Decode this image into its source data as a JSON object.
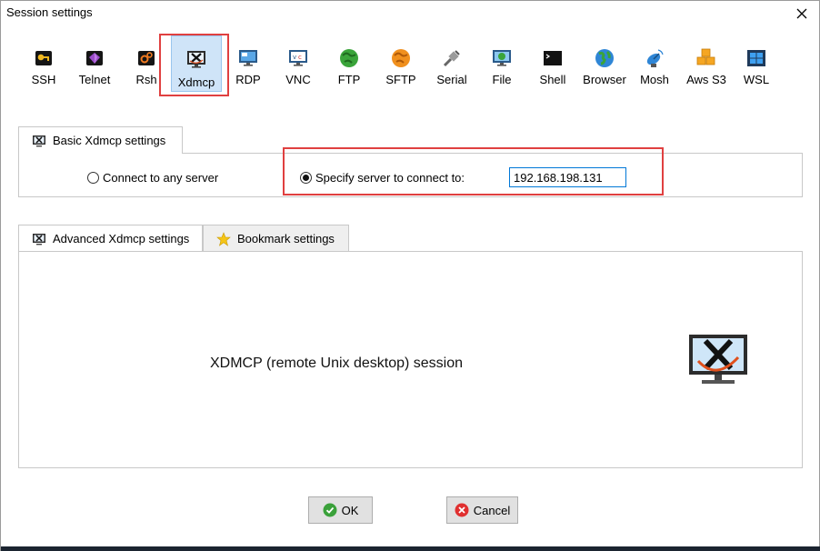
{
  "window": {
    "title": "Session settings"
  },
  "session_types": [
    {
      "label": "SSH",
      "icon": "key-icon"
    },
    {
      "label": "Telnet",
      "icon": "telnet-gem-icon"
    },
    {
      "label": "Rsh",
      "icon": "rsh-gears-icon"
    },
    {
      "label": "Xdmcp",
      "icon": "x-window-icon",
      "selected": true
    },
    {
      "label": "RDP",
      "icon": "rdp-monitor-icon"
    },
    {
      "label": "VNC",
      "icon": "vnc-monitor-icon"
    },
    {
      "label": "FTP",
      "icon": "ftp-globe-icon"
    },
    {
      "label": "SFTP",
      "icon": "sftp-globe-icon"
    },
    {
      "label": "Serial",
      "icon": "serial-plug-icon"
    },
    {
      "label": "File",
      "icon": "file-monitor-icon"
    },
    {
      "label": "Shell",
      "icon": "shell-terminal-icon"
    },
    {
      "label": "Browser",
      "icon": "browser-globe-icon"
    },
    {
      "label": "Mosh",
      "icon": "mosh-satellite-icon"
    },
    {
      "label": "Aws S3",
      "icon": "aws-s3-cubes-icon"
    },
    {
      "label": "WSL",
      "icon": "wsl-windows-icon"
    }
  ],
  "basic_tab": {
    "label": "Basic Xdmcp settings"
  },
  "basic": {
    "radio_any": "Connect to any server",
    "radio_specify": "Specify server to connect to:",
    "selected_option": "specify",
    "server_value": "192.168.198.131"
  },
  "advanced_tabs": [
    {
      "label": "Advanced Xdmcp settings",
      "icon": "x-window-icon",
      "active": true
    },
    {
      "label": "Bookmark settings",
      "icon": "star-icon",
      "active": false
    }
  ],
  "description": "XDMCP (remote Unix desktop) session",
  "buttons": {
    "ok": "OK",
    "cancel": "Cancel"
  },
  "colors": {
    "highlight_red": "#e04040",
    "selected_bg": "#cfe4f8",
    "input_border": "#0078d7",
    "ok_green": "#3aa13a",
    "cancel_red": "#e03030"
  }
}
